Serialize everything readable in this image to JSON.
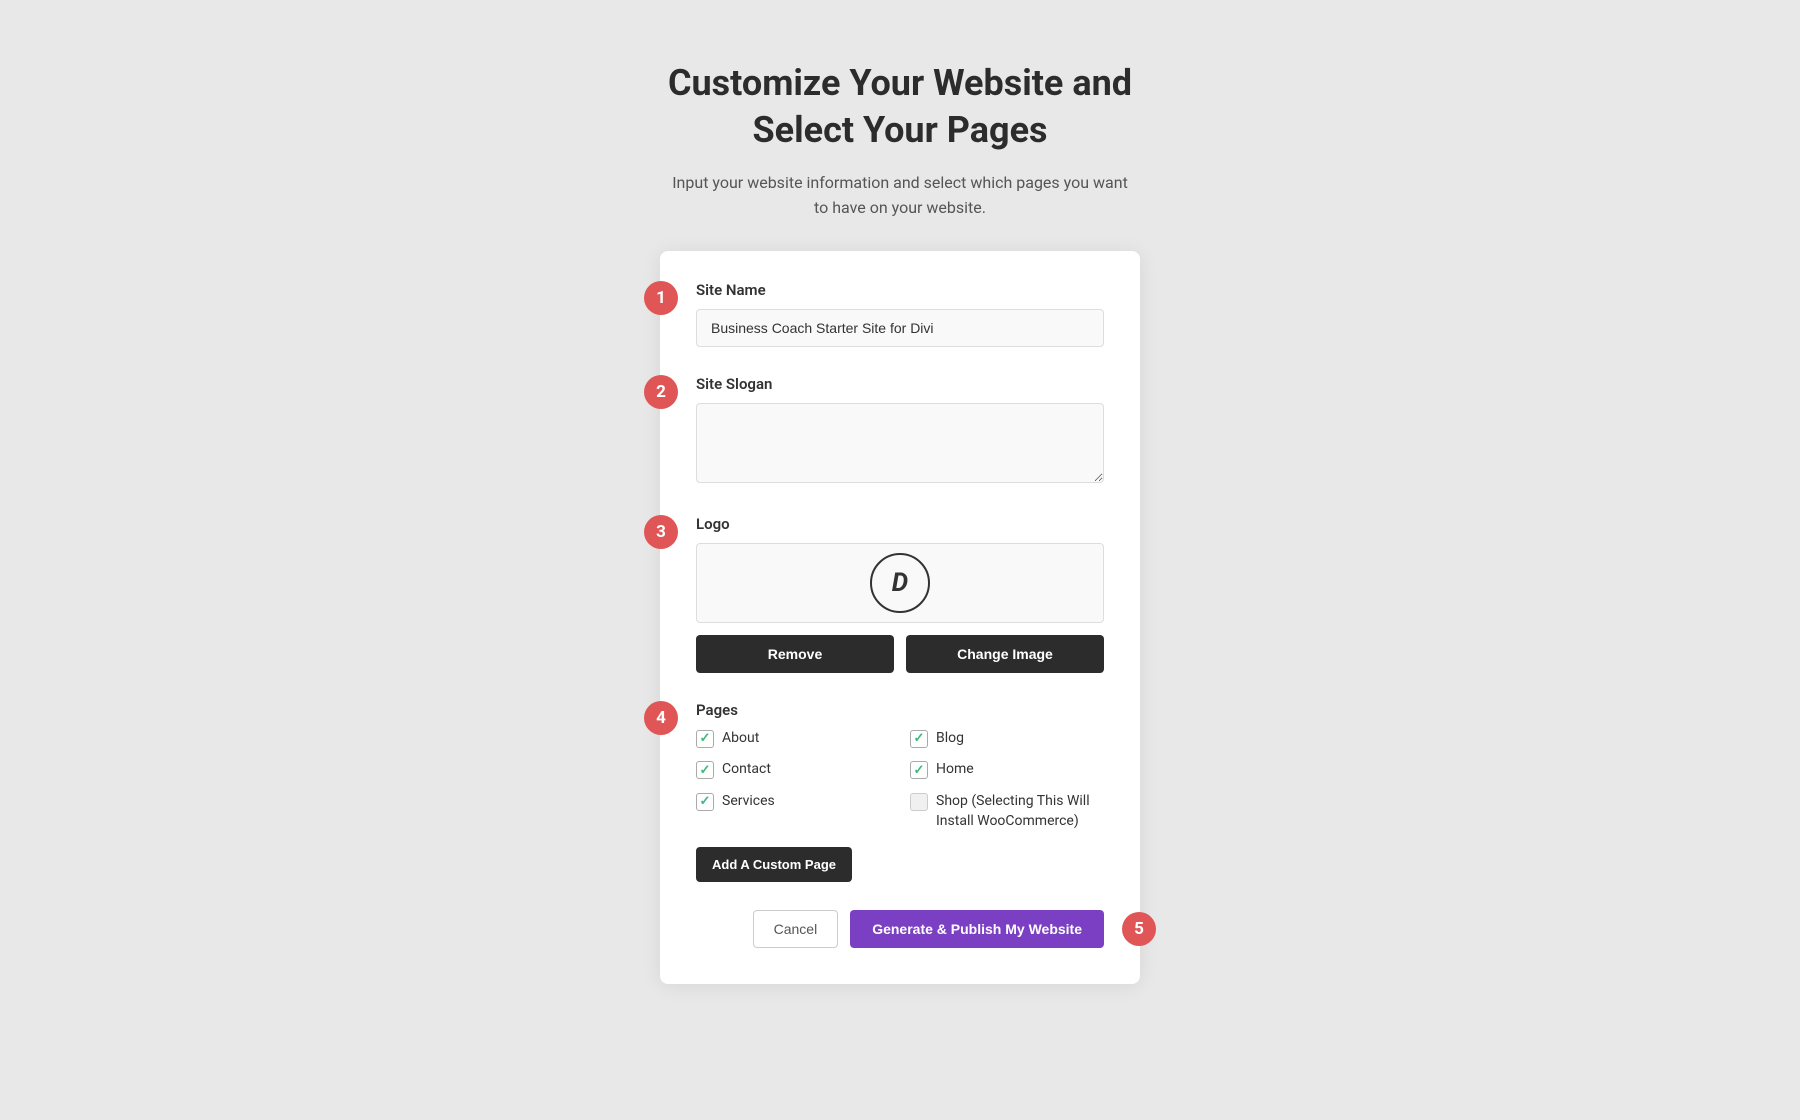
{
  "page": {
    "title_line1": "Customize Your Website and",
    "title_line2": "Select Your Pages",
    "subtitle": "Input your website information and select which pages you want to have on your website."
  },
  "steps": {
    "step1": "1",
    "step2": "2",
    "step3": "3",
    "step4": "4",
    "step5": "5"
  },
  "form": {
    "site_name_label": "Site Name",
    "site_name_value": "Business Coach Starter Site for Divi",
    "site_name_placeholder": "Business Coach Starter Site for Divi",
    "site_slogan_label": "Site Slogan",
    "site_slogan_value": "",
    "site_slogan_placeholder": "",
    "logo_label": "Logo",
    "logo_icon_text": "D",
    "remove_button": "Remove",
    "change_image_button": "Change Image",
    "pages_label": "Pages",
    "pages": [
      {
        "id": "about",
        "label": "About",
        "checked": true,
        "col": 1
      },
      {
        "id": "blog",
        "label": "Blog",
        "checked": true,
        "col": 2
      },
      {
        "id": "contact",
        "label": "Contact",
        "checked": true,
        "col": 1
      },
      {
        "id": "home",
        "label": "Home",
        "checked": true,
        "col": 2
      },
      {
        "id": "services",
        "label": "Services",
        "checked": true,
        "col": 1
      },
      {
        "id": "shop",
        "label": "Shop (Selecting This Will Install WooCommerce)",
        "checked": false,
        "col": 2
      }
    ],
    "add_custom_page_button": "Add A Custom Page",
    "cancel_button": "Cancel",
    "publish_button": "Generate & Publish My Website"
  }
}
